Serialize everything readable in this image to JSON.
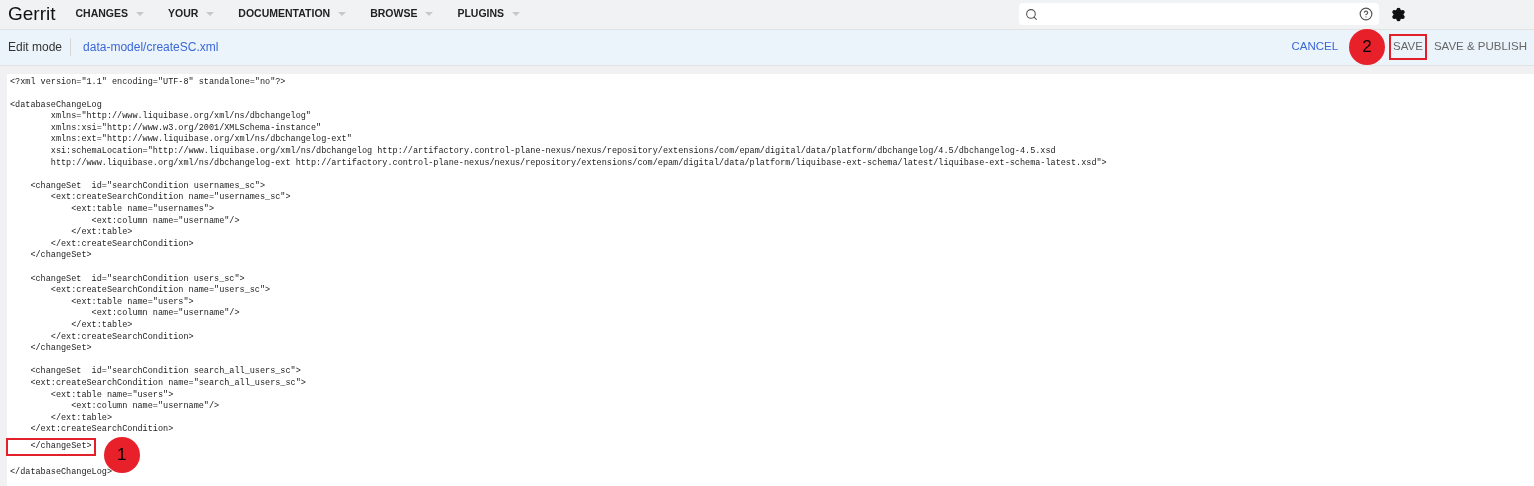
{
  "header": {
    "logo": "Gerrit",
    "menu": [
      {
        "label": "CHANGES"
      },
      {
        "label": "YOUR"
      },
      {
        "label": "DOCUMENTATION"
      },
      {
        "label": "BROWSE"
      },
      {
        "label": "PLUGINS"
      }
    ]
  },
  "edit_bar": {
    "mode": "Edit mode",
    "file_path": "data-model/createSC.xml",
    "actions": [
      {
        "label": "CANCEL",
        "kind": "link",
        "highlighted": false
      },
      {
        "label": "SAVE",
        "kind": "plain",
        "highlighted": true,
        "callout": "2"
      },
      {
        "label": "SAVE & PUBLISH",
        "kind": "plain",
        "highlighted": false
      }
    ]
  },
  "editor": {
    "blocks": [
      [
        {
          "text": "<?xml version=\"1.1\" encoding=\"UTF-8\" standalone=\"no\"?>",
          "highlighted": false
        }
      ],
      [
        {
          "text": "<databaseChangeLog",
          "highlighted": false
        },
        {
          "text": "        xmlns=\"http://www.liquibase.org/xml/ns/dbchangelog\"",
          "highlighted": false
        },
        {
          "text": "        xmlns:xsi=\"http://www.w3.org/2001/XMLSchema-instance\"",
          "highlighted": false
        },
        {
          "text": "        xmlns:ext=\"http://www.liquibase.org/xml/ns/dbchangelog-ext\"",
          "highlighted": false
        },
        {
          "text": "        xsi:schemaLocation=\"http://www.liquibase.org/xml/ns/dbchangelog http://artifactory.control-plane-nexus/nexus/repository/extensions/com/epam/digital/data/platform/dbchangelog/4.5/dbchangelog-4.5.xsd",
          "highlighted": false
        },
        {
          "text": "        http://www.liquibase.org/xml/ns/dbchangelog-ext http://artifactory.control-plane-nexus/nexus/repository/extensions/com/epam/digital/data/platform/liquibase-ext-schema/latest/liquibase-ext-schema-latest.xsd\">",
          "highlighted": false
        }
      ],
      [
        {
          "text": "    <changeSet  id=\"searchCondition usernames_sc\">",
          "highlighted": false
        },
        {
          "text": "        <ext:createSearchCondition name=\"usernames_sc\">",
          "highlighted": false
        },
        {
          "text": "            <ext:table name=\"usernames\">",
          "highlighted": false
        },
        {
          "text": "                <ext:column name=\"username\"/>",
          "highlighted": false
        },
        {
          "text": "            </ext:table>",
          "highlighted": false
        },
        {
          "text": "        </ext:createSearchCondition>",
          "highlighted": false
        },
        {
          "text": "    </changeSet>",
          "highlighted": false
        }
      ],
      [
        {
          "text": "    <changeSet  id=\"searchCondition users_sc\">",
          "highlighted": false
        },
        {
          "text": "        <ext:createSearchCondition name=\"users_sc\">",
          "highlighted": false
        },
        {
          "text": "            <ext:table name=\"users\">",
          "highlighted": false
        },
        {
          "text": "                <ext:column name=\"username\"/>",
          "highlighted": false
        },
        {
          "text": "            </ext:table>",
          "highlighted": false
        },
        {
          "text": "        </ext:createSearchCondition>",
          "highlighted": false
        },
        {
          "text": "    </changeSet>",
          "highlighted": false
        }
      ],
      [
        {
          "text": "    <changeSet  id=\"searchCondition search_all_users_sc\">",
          "highlighted": false
        },
        {
          "text": "    <ext:createSearchCondition name=\"search_all_users_sc\">",
          "highlighted": false
        },
        {
          "text": "        <ext:table name=\"users\">",
          "highlighted": false
        },
        {
          "text": "            <ext:column name=\"username\"/>",
          "highlighted": false
        },
        {
          "text": "        </ext:table>",
          "highlighted": false
        },
        {
          "text": "    </ext:createSearchCondition>",
          "highlighted": false
        },
        {
          "text": "    </changeSet>",
          "highlighted": true,
          "callout": "1"
        }
      ],
      [
        {
          "text": "</databaseChangeLog>",
          "highlighted": false
        }
      ]
    ]
  }
}
